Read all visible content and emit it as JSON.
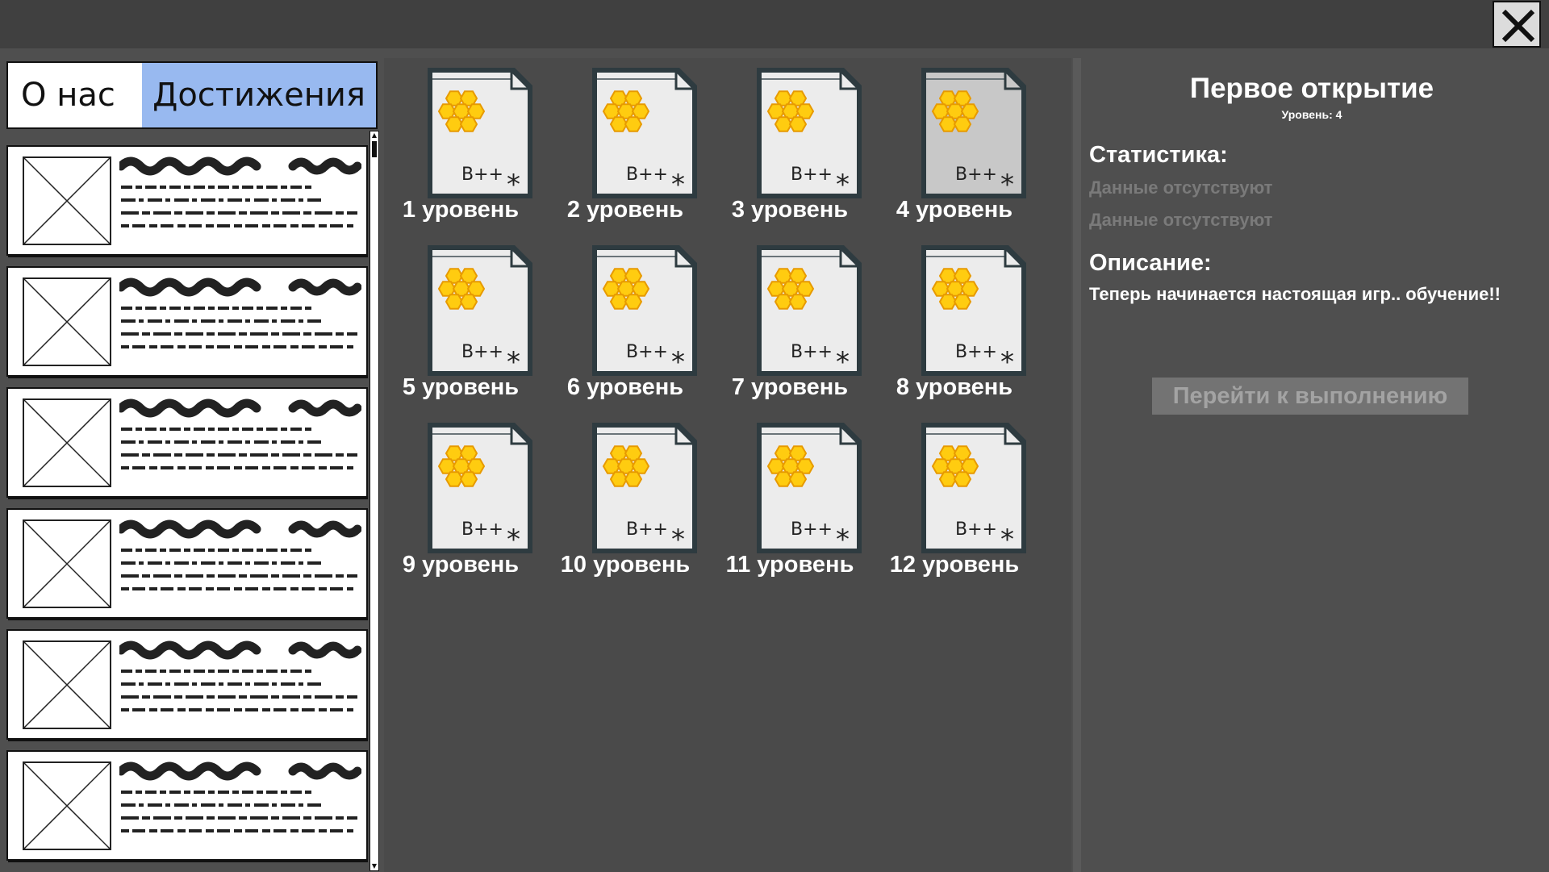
{
  "window": {
    "close_icon": "close-x-icon"
  },
  "tabs": {
    "about": "О нас",
    "achievements": "Достижения",
    "active_color": "#98b9f0"
  },
  "list": {
    "card_count": 6,
    "thumb_icon": "image-placeholder-icon"
  },
  "levels": [
    {
      "label": "1 уровень",
      "icon_text": "B++"
    },
    {
      "label": "2 уровень",
      "icon_text": "B++"
    },
    {
      "label": "3 уровень",
      "icon_text": "B++"
    },
    {
      "label": "4 уровень",
      "icon_text": "B++",
      "selected": true
    },
    {
      "label": "5 уровень",
      "icon_text": "B++"
    },
    {
      "label": "6 уровень",
      "icon_text": "B++"
    },
    {
      "label": "7 уровень",
      "icon_text": "B++"
    },
    {
      "label": "8 уровень",
      "icon_text": "B++"
    },
    {
      "label": "9 уровень",
      "icon_text": "B++"
    },
    {
      "label": "10 уровень",
      "icon_text": "B++"
    },
    {
      "label": "11 уровень",
      "icon_text": "B++"
    },
    {
      "label": "12 уровень",
      "icon_text": "B++"
    }
  ],
  "details": {
    "title": "Первое открытие",
    "level": "Уровень: 4",
    "stats_heading": "Статистика:",
    "stats": [
      "Данные отсутствуют",
      "Данные отсутствуют"
    ],
    "desc_heading": "Описание:",
    "description": "Теперь начинается настоящая игр.. обучение!!",
    "go_button": "Перейти к выполнению"
  }
}
